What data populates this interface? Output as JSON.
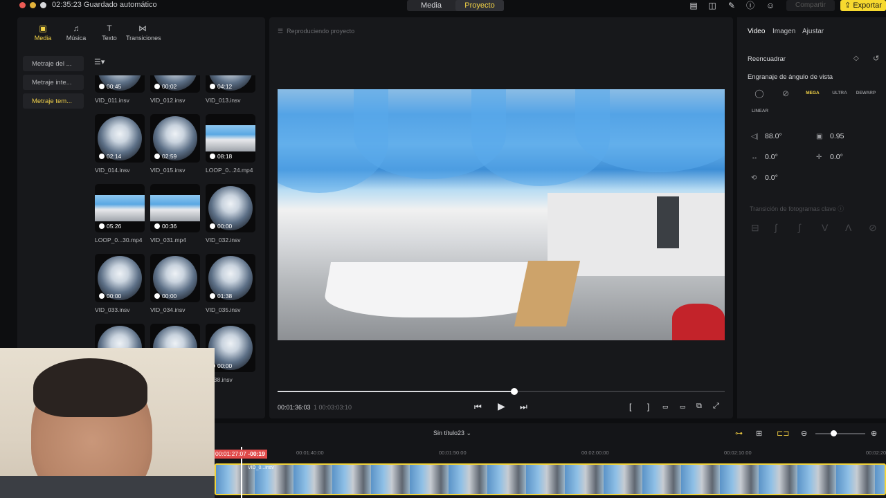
{
  "titlebar": {
    "autosave": "02:35:23 Guardado automático",
    "modes": [
      "Media",
      "Proyecto"
    ],
    "active_mode": "Proyecto",
    "share": "Compartir",
    "export": "Exportar"
  },
  "left_tabs": [
    {
      "label": "Media",
      "icon": "folder-icon"
    },
    {
      "label": "Música",
      "icon": "music-icon"
    },
    {
      "label": "Texto",
      "icon": "text-icon"
    },
    {
      "label": "Transiciones",
      "icon": "transition-icon"
    }
  ],
  "folders": [
    "Metraje del ...",
    "Metraje inte...",
    "Metraje tem..."
  ],
  "media": [
    {
      "name": "VID_011.insv",
      "dur": "00:45",
      "kind": "sphere"
    },
    {
      "name": "VID_012.insv",
      "dur": "00:02",
      "kind": "sphere"
    },
    {
      "name": "VID_013.insv",
      "dur": "04:12",
      "kind": "sphere"
    },
    {
      "name": "VID_014.insv",
      "dur": "02:14",
      "kind": "sphere"
    },
    {
      "name": "VID_015.insv",
      "dur": "02:59",
      "kind": "sphere"
    },
    {
      "name": "LOOP_0...24.mp4",
      "dur": "08:18",
      "kind": "pano"
    },
    {
      "name": "LOOP_0...30.mp4",
      "dur": "05:26",
      "kind": "pano"
    },
    {
      "name": "VID_031.mp4",
      "dur": "00:36",
      "kind": "pano"
    },
    {
      "name": "VID_032.insv",
      "dur": "00:00",
      "kind": "sphere"
    },
    {
      "name": "VID_033.insv",
      "dur": "00:00",
      "kind": "sphere"
    },
    {
      "name": "VID_034.insv",
      "dur": "00:00",
      "kind": "sphere"
    },
    {
      "name": "VID_035.insv",
      "dur": "01:38",
      "kind": "sphere"
    },
    {
      "name": "",
      "dur": "",
      "kind": "sphere"
    },
    {
      "name": "",
      "dur": "",
      "kind": "sphere"
    },
    {
      "name": "...038.insv",
      "dur": "00:00",
      "kind": "sphere"
    }
  ],
  "preview": {
    "header": "Reproduciendo proyecto",
    "time_current": "00:01:36:03",
    "time_total": "1 00:03:03:10",
    "progress": 0.53
  },
  "right": {
    "tabs": [
      "Video",
      "Imagen",
      "Ajustar"
    ],
    "reframe": "Reencuadrar",
    "lens_label": "Engranaje de ángulo de vista",
    "lens_options": [
      "MEGA",
      "ULTRA",
      "DEWARP",
      "LINEAR"
    ],
    "fov": "88.0°",
    "distance": "0.95",
    "pan": "0.0°",
    "tilt": "0.0°",
    "roll": "0.0°",
    "keyframe_label": "Transición de fotogramas clave"
  },
  "timeline": {
    "sequence": "Sin título23",
    "ruler": [
      "00:01:40:00",
      "00:01:50:00",
      "00:02:00:00",
      "00:02:10:00",
      "00:02:20"
    ],
    "playhead_time": "00:01:27:07",
    "playhead_offset": "-00:19",
    "clip_label": "VID_0...insv"
  }
}
